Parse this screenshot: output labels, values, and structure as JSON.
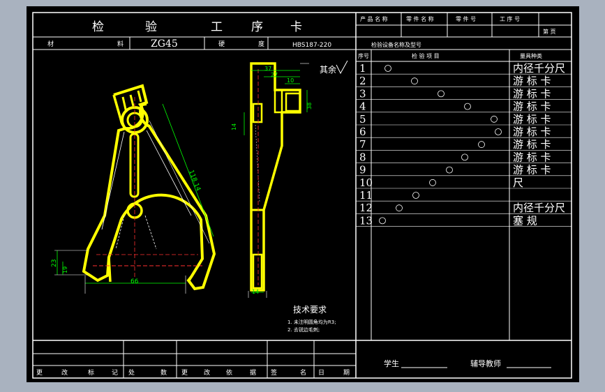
{
  "header": {
    "title_chars": [
      "检",
      "验",
      "工",
      "序",
      "卡"
    ],
    "product_name": "产 品 名 称",
    "part_name": "零 件 名 称",
    "part_no": "零 件 号",
    "process_no": "工 序 号",
    "page": "第  页"
  },
  "material_row": {
    "material_label_1": "材",
    "material_label_2": "料",
    "material_value": "ZG45",
    "hardness_label_1": "硬",
    "hardness_label_2": "度",
    "hardness_value": "HBS187-220",
    "equipment_label": "检验设备名称及型号"
  },
  "drawing": {
    "dims": [
      "118.14",
      "23",
      "19",
      "66",
      "37",
      "27",
      "10",
      "38",
      "14",
      "140",
      "14"
    ],
    "roughness_note": "其余",
    "tech_title": "技术要求",
    "tech_notes": [
      "1. 未注明圆角均为R3;",
      "2. 去锐边毛刺;"
    ]
  },
  "inspection": {
    "col_no": "序号",
    "col_item": "检  验  项  目",
    "col_tool": "量具种类",
    "rows": [
      {
        "no": "1",
        "tool": "内径千分尺"
      },
      {
        "no": "2",
        "tool": "游 标 卡"
      },
      {
        "no": "3",
        "tool": "游 标 卡"
      },
      {
        "no": "4",
        "tool": "游 标 卡"
      },
      {
        "no": "5",
        "tool": "游 标 卡"
      },
      {
        "no": "6",
        "tool": "游 标 卡"
      },
      {
        "no": "7",
        "tool": "游 标 卡"
      },
      {
        "no": "8",
        "tool": "游 标 卡"
      },
      {
        "no": "9",
        "tool": "游 标 卡"
      },
      {
        "no": "10",
        "tool": "尺"
      },
      {
        "no": "11",
        "tool": ""
      },
      {
        "no": "12",
        "tool": "内径千分尺"
      },
      {
        "no": "13",
        "tool": "塞 规"
      }
    ]
  },
  "footer": {
    "labels": [
      "更",
      "改",
      "标",
      "记",
      "处",
      "数",
      "更",
      "改",
      "依",
      "据",
      "签",
      "名",
      "日",
      "期"
    ],
    "student": "学生",
    "teacher": "辅导教师"
  }
}
